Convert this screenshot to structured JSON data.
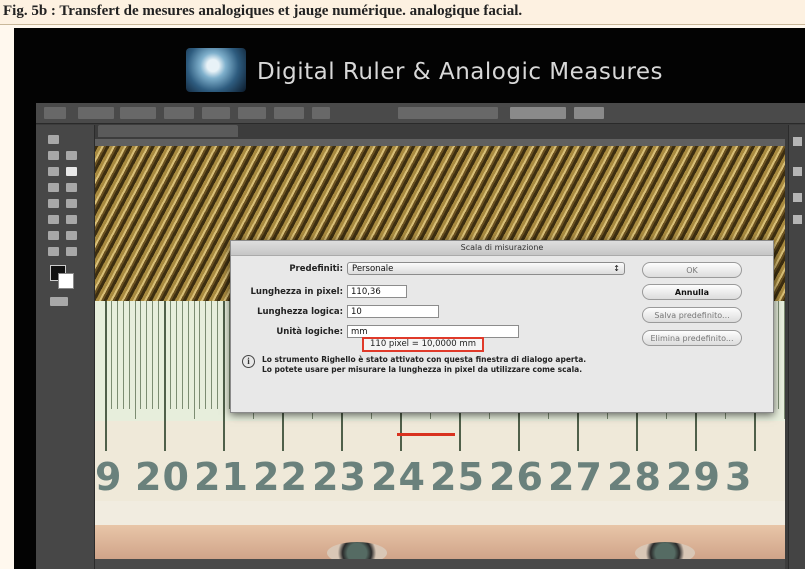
{
  "caption": "Fig. 5b : Transfert de mesures analogiques et jauge numérique. analogique facial.",
  "banner": {
    "title": "Digital Ruler & Analogic Measures",
    "logo_icon": "face-logo-icon"
  },
  "dialog": {
    "title": "Scala di misurazione",
    "preset_label": "Predefiniti:",
    "preset_value": "Personale",
    "pixel_length_label": "Lunghezza in pixel:",
    "pixel_length_value": "110,36",
    "logical_length_label": "Lunghezza logica:",
    "logical_length_value": "10",
    "logical_units_label": "Unità logiche:",
    "logical_units_value": "mm",
    "result_text": "110 pixel = 10,0000 mm",
    "note_line1": "Lo strumento Righello è stato attivato con questa finestra di dialogo aperta.",
    "note_line2": "Lo potete usare per misurare la lunghezza in pixel da utilizzare come scala.",
    "buttons": {
      "ok": "OK",
      "cancel": "Annulla",
      "save_preset": "Salva predefinito...",
      "delete_preset": "Elimina predefinito..."
    }
  },
  "ruler": {
    "numbers": [
      "9",
      "20",
      "21",
      "22",
      "23",
      "24",
      "25",
      "26",
      "27",
      "28",
      "29",
      "3"
    ],
    "mark_color": "#d9321f"
  },
  "colors": {
    "highlight_box": "#e03a2a",
    "ruler_digits": "#6a817c"
  }
}
